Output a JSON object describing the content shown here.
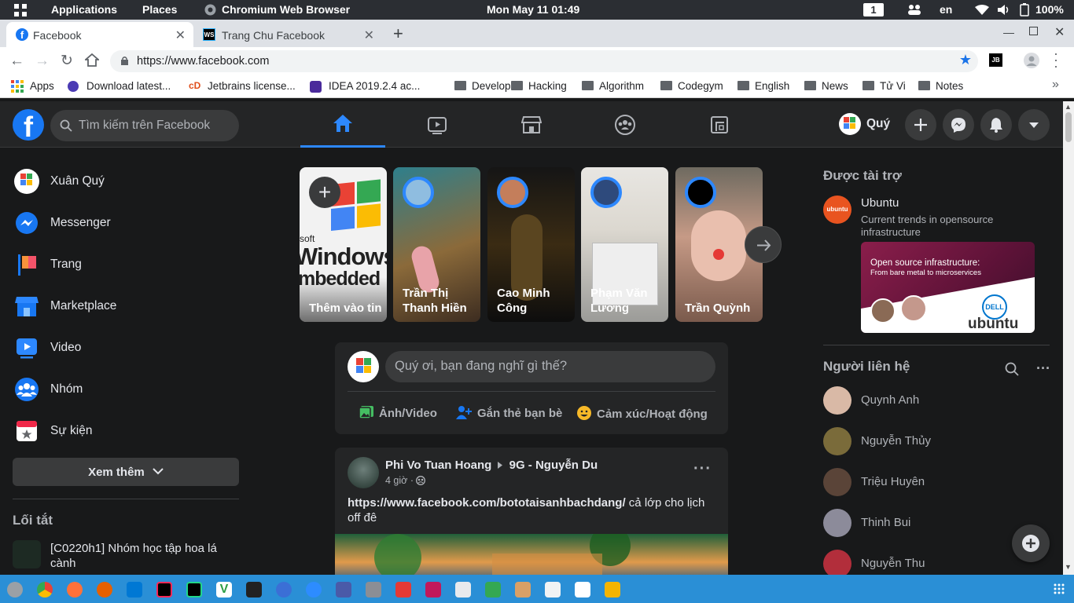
{
  "os": {
    "applications": "Applications",
    "places": "Places",
    "active_app": "Chromium Web Browser",
    "datetime": "Mon May 11   01:49",
    "workspace": "1",
    "lang": "en",
    "battery": "100%"
  },
  "tabs": [
    {
      "label": "Facebook"
    },
    {
      "label": "Trang Chu Facebook"
    }
  ],
  "address": {
    "url": "https://www.facebook.com"
  },
  "bookmarks": [
    "Apps",
    "Download latest...",
    "Jetbrains license...",
    "IDEA 2019.2.4 ac...",
    "Developer",
    "Hacking",
    "Algorithm",
    "Codegym",
    "English",
    "News",
    "Tử Vi",
    "Notes"
  ],
  "fb": {
    "search_placeholder": "Tìm kiếm trên Facebook",
    "profile_name": "Quý",
    "sidebar": [
      {
        "label": "Xuân Quý",
        "icon": "avatar"
      },
      {
        "label": "Messenger",
        "icon": "messenger-icon"
      },
      {
        "label": "Trang",
        "icon": "flag-icon"
      },
      {
        "label": "Marketplace",
        "icon": "shop-icon"
      },
      {
        "label": "Video",
        "icon": "video-icon"
      },
      {
        "label": "Nhóm",
        "icon": "group-icon"
      },
      {
        "label": "Sự kiện",
        "icon": "calendar-icon"
      }
    ],
    "see_more": "Xem thêm",
    "shortcuts_title": "Lối tắt",
    "shortcut_item": "[C0220h1] Nhóm học tập hoa lá cành",
    "stories": [
      {
        "name": "Thêm vào tin"
      },
      {
        "name": "Trần Thị Thanh Hiền"
      },
      {
        "name": "Cao Minh Công"
      },
      {
        "name": "Phạm Văn Lương"
      },
      {
        "name": "Trần Quỳnh"
      }
    ],
    "story_add_bg_text1": "soft",
    "story_add_bg_text2": "Windows",
    "story_add_bg_text3": "mbedded",
    "composer": {
      "placeholder": "Quý ơi, bạn đang nghĩ gì thế?",
      "photo": "Ảnh/Video",
      "tag": "Gắn thẻ bạn bè",
      "feeling": "Cảm xúc/Hoạt động"
    },
    "post": {
      "author": "Phi Vo Tuan Hoang",
      "group": "9G - Nguyễn Du",
      "time": "4 giờ · ",
      "link": "https://www.facebook.com/bototaisanhbachdang/",
      "text": " cả lớp cho lịch off đê"
    },
    "sponsored_title": "Được tài trợ",
    "ad": {
      "name": "Ubuntu",
      "desc": "Current trends in opensource infrastructure",
      "img_line1": "Open source infrastructure:",
      "img_line2": "From bare metal to microservices",
      "img_brand": "ubuntu",
      "img_partner": "DELL"
    },
    "contacts_title": "Người liên hệ",
    "contacts": [
      "Quynh Anh",
      "Nguyễn Thủy",
      "Triệu Huyên",
      "Thinh Bui",
      "Nguyễn Thu"
    ]
  },
  "colors": {
    "fb_blue": "#2d88ff",
    "bg": "#18191a",
    "card": "#242526"
  }
}
